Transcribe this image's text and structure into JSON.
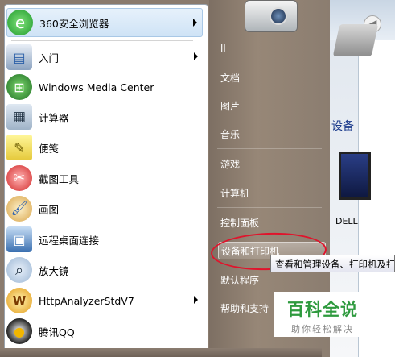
{
  "start_menu": {
    "programs": [
      {
        "label": "360安全浏览器",
        "icon": "360-browser-icon",
        "has_submenu": true
      },
      {
        "label": "入门",
        "icon": "getting-started-icon",
        "has_submenu": true
      },
      {
        "label": "Windows Media Center",
        "icon": "windows-media-center-icon",
        "has_submenu": false
      },
      {
        "label": "计算器",
        "icon": "calculator-icon",
        "has_submenu": false
      },
      {
        "label": "便笺",
        "icon": "sticky-notes-icon",
        "has_submenu": false
      },
      {
        "label": "截图工具",
        "icon": "snipping-tool-icon",
        "has_submenu": false
      },
      {
        "label": "画图",
        "icon": "paint-icon",
        "has_submenu": false
      },
      {
        "label": "远程桌面连接",
        "icon": "remote-desktop-icon",
        "has_submenu": false
      },
      {
        "label": "放大镜",
        "icon": "magnifier-icon",
        "has_submenu": false
      },
      {
        "label": "HttpAnalyzerStdV7",
        "icon": "http-analyzer-icon",
        "has_submenu": true
      },
      {
        "label": "腾讯QQ",
        "icon": "qq-penguin-icon",
        "has_submenu": false
      }
    ],
    "right_items": [
      {
        "label": "ll"
      },
      {
        "label": "文档"
      },
      {
        "label": "图片"
      },
      {
        "label": "音乐"
      },
      {
        "label": "游戏"
      },
      {
        "label": "计算机"
      },
      {
        "label": "控制面板"
      },
      {
        "label": "设备和打印机"
      },
      {
        "label": "默认程序"
      },
      {
        "label": "帮助和支持"
      }
    ]
  },
  "tooltip": "查看和管理设备、打印机及打",
  "background_window": {
    "section_label": "设备",
    "device_label": "DELL"
  },
  "watermark": {
    "title": "百科全说",
    "subtitle": "助你轻松解决"
  },
  "colors": {
    "highlight_ellipse": "#e0142c",
    "watermark_green": "#2e9a3e"
  }
}
